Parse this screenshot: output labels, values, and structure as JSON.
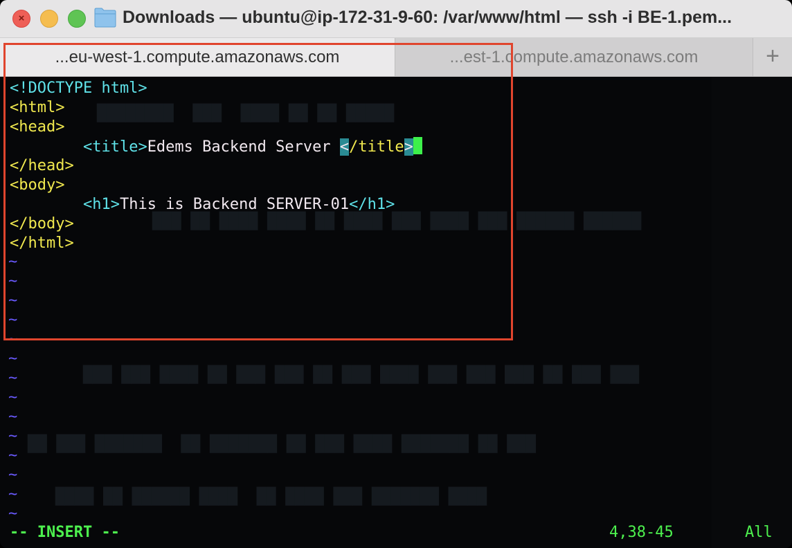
{
  "window": {
    "title": "Downloads — ubuntu@ip-172-31-9-60: /var/www/html — ssh -i BE-1.pem..."
  },
  "tabs": [
    {
      "label": "...eu-west-1.compute.amazonaws.com",
      "active": true
    },
    {
      "label": "...est-1.compute.amazonaws.com",
      "active": false
    }
  ],
  "tab_add_label": "+",
  "editor": {
    "lines": {
      "doctype": "<!DOCTYPE html>",
      "html_open": "<html>",
      "head_open": "<head>",
      "title_indent": "        ",
      "title_open": "<title>",
      "title_text": "Edems Backend Server ",
      "title_close_lt": "<",
      "title_close_tag": "/title",
      "title_close_gt": ">",
      "head_close": "</head>",
      "body_open": "<body>",
      "h1_indent": "        ",
      "h1_open": "<h1>",
      "h1_text": "This is Backend SERVER-01",
      "h1_close": "</h1>",
      "body_close": "</body>",
      "html_close": "</html>"
    },
    "tilde": "~"
  },
  "status": {
    "mode": "-- INSERT --",
    "position": "4,38-45",
    "scroll": "All"
  },
  "colors": {
    "tag": "#5fe2e9",
    "tag_name": "#f0e84e",
    "text": "#f2e9f0",
    "tilde": "#6a5aff",
    "status": "#4df04e",
    "annotation": "#e0452d"
  }
}
